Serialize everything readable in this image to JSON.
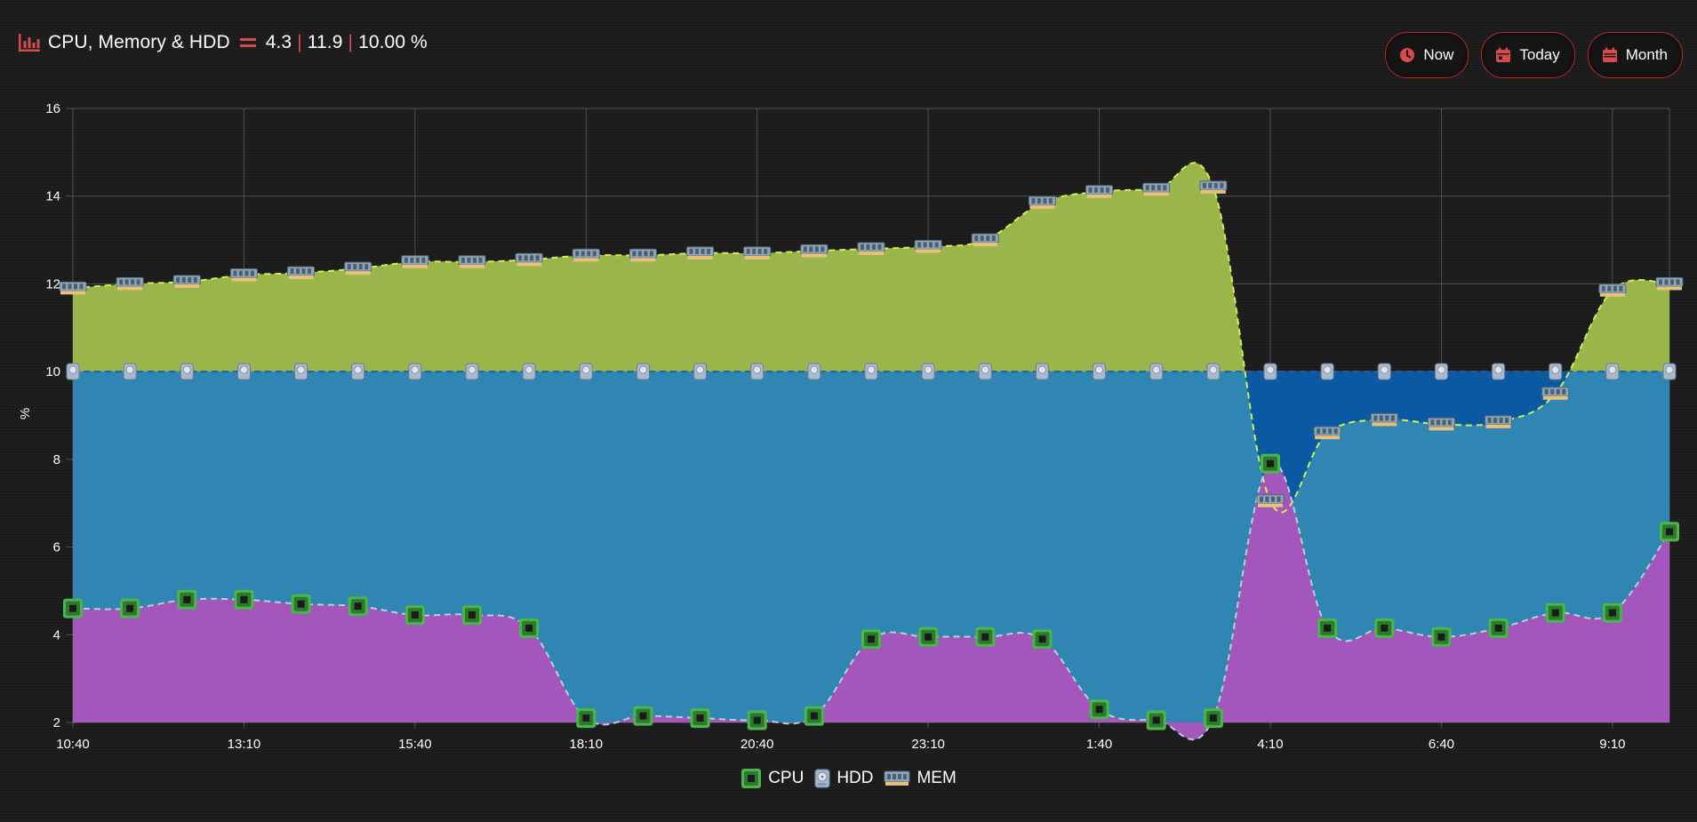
{
  "header": {
    "title": "CPU, Memory & HDD",
    "cpu_value": "4.3",
    "mem_value": "11.9",
    "hdd_value": "10.00 %",
    "separator": "|"
  },
  "buttons": {
    "now": "Now",
    "today": "Today",
    "month": "Month"
  },
  "colors": {
    "accent": "#d94a4a",
    "cpu_fill": "#a356bb",
    "hdd_fill": "#2f86b2",
    "hdd_over_fill": "#0a5aa3",
    "mem_fill": "#9ab54a",
    "mem_line": "#d4ee52",
    "cpu_line": "#b6d0de",
    "hdd_line": "#1f5fae"
  },
  "icons": {
    "title": "bar-chart-icon",
    "equals": "equals-icon",
    "now": "clock-icon",
    "today": "calendar-icon",
    "month": "calendar-icon",
    "cpu": "cpu-chip-icon",
    "hdd": "hard-disk-icon",
    "mem": "memory-module-icon"
  },
  "chart_data": {
    "type": "area",
    "ylabel": "%",
    "ylim": [
      2,
      16
    ],
    "yticks": [
      "2",
      "4",
      "6",
      "8",
      "10",
      "12",
      "14",
      "16"
    ],
    "xtick_labels": [
      "10:40",
      "13:10",
      "15:40",
      "18:10",
      "20:40",
      "23:10",
      "1:40",
      "4:10",
      "6:40",
      "9:10"
    ],
    "grid": true,
    "legend_position": "bottom",
    "x_count": 29,
    "series": [
      {
        "name": "CPU",
        "values": [
          4.6,
          4.6,
          4.8,
          4.8,
          4.7,
          4.65,
          4.45,
          4.45,
          4.15,
          2.1,
          2.15,
          2.1,
          2.05,
          2.15,
          3.9,
          3.95,
          3.95,
          3.9,
          2.3,
          2.05,
          2.1,
          7.9,
          4.15,
          4.15,
          3.95,
          4.15,
          4.5,
          4.5,
          6.35
        ]
      },
      {
        "name": "HDD",
        "values": [
          10,
          10,
          10,
          10,
          10,
          10,
          10,
          10,
          10,
          10,
          10,
          10,
          10,
          10,
          10,
          10,
          10,
          10,
          10,
          10,
          10,
          10,
          10,
          10,
          10,
          10,
          10,
          10,
          10
        ]
      },
      {
        "name": "MEM",
        "values": [
          11.9,
          12.0,
          12.05,
          12.2,
          12.25,
          12.35,
          12.5,
          12.5,
          12.55,
          12.65,
          12.65,
          12.7,
          12.7,
          12.75,
          12.8,
          12.85,
          13.0,
          13.85,
          14.1,
          14.15,
          14.2,
          7.05,
          8.6,
          8.9,
          8.8,
          8.85,
          9.5,
          11.85,
          12.0
        ]
      }
    ]
  }
}
